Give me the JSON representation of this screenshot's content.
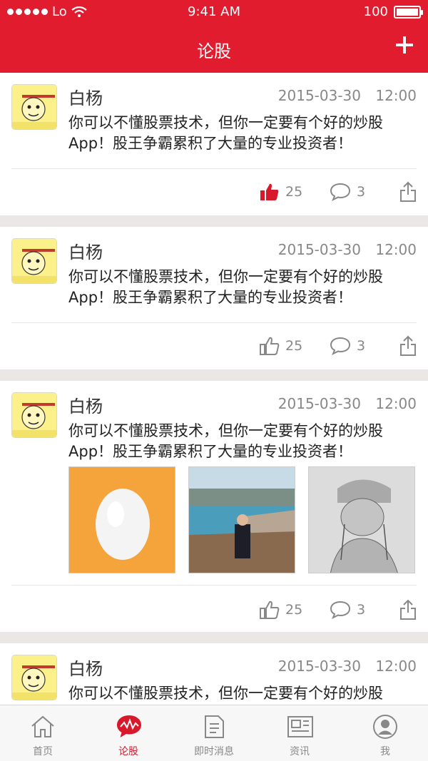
{
  "status_bar": {
    "carrier": "Lo",
    "time": "9:41 AM",
    "battery": "100"
  },
  "header": {
    "title": "论股"
  },
  "posts": [
    {
      "user": "白杨",
      "date": "2015-03-30",
      "time": "12:00",
      "text": "你可以不懂股票技术，但你一定要有个好的炒股App！股王争霸累积了大量的专业投资者！",
      "likes": "25",
      "comments": "3",
      "liked": true
    },
    {
      "user": "白杨",
      "date": "2015-03-30",
      "time": "12:00",
      "text": "你可以不懂股票技术，但你一定要有个好的炒股App！股王争霸累积了大量的专业投资者！",
      "likes": "25",
      "comments": "3",
      "liked": false
    },
    {
      "user": "白杨",
      "date": "2015-03-30",
      "time": "12:00",
      "text": "你可以不懂股票技术，但你一定要有个好的炒股App！股王争霸累积了大量的专业投资者！",
      "likes": "25",
      "comments": "3",
      "liked": false,
      "photos": [
        "egg-photo",
        "coast-photo",
        "sketch-photo"
      ]
    },
    {
      "user": "白杨",
      "date": "2015-03-30",
      "time": "12:00",
      "text": "你可以不懂股票技术，但你一定要有个好的炒股"
    }
  ],
  "tabs": [
    {
      "label": "首页",
      "icon": "home-icon"
    },
    {
      "label": "论股",
      "icon": "discuss-icon"
    },
    {
      "label": "即时消息",
      "icon": "message-icon"
    },
    {
      "label": "资讯",
      "icon": "news-icon"
    },
    {
      "label": "我",
      "icon": "profile-icon"
    }
  ],
  "colors": {
    "brand": "#e21c2f",
    "active_tab": "#d8192b",
    "like_active": "#d8192b",
    "muted": "#888888"
  }
}
